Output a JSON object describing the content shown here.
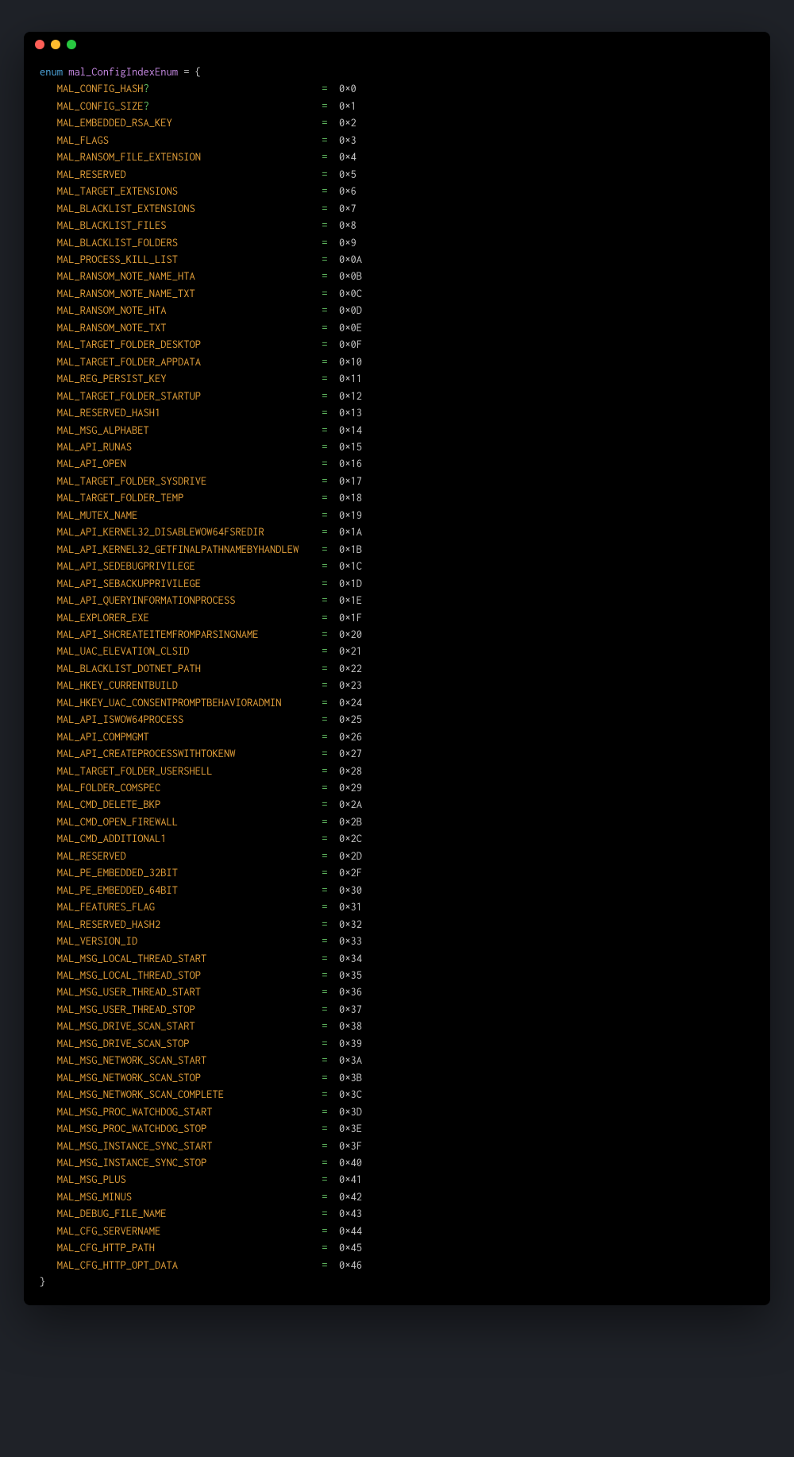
{
  "declaration": {
    "keyword": "enum",
    "identifier": "mal_ConfigIndexEnum",
    "equals": "=",
    "open_brace": "{",
    "close_brace": "}"
  },
  "indent": "   ",
  "name_col_width": 46,
  "members": [
    {
      "name": "MAL_CONFIG_HASH",
      "q": "?",
      "value": "0×0"
    },
    {
      "name": "MAL_CONFIG_SIZE",
      "q": "?",
      "value": "0×1"
    },
    {
      "name": "MAL_EMBEDDED_RSA_KEY",
      "q": "",
      "value": "0×2"
    },
    {
      "name": "MAL_FLAGS",
      "q": "",
      "value": "0×3"
    },
    {
      "name": "MAL_RANSOM_FILE_EXTENSION",
      "q": "",
      "value": "0×4"
    },
    {
      "name": "MAL_RESERVED",
      "q": "",
      "value": "0×5"
    },
    {
      "name": "MAL_TARGET_EXTENSIONS",
      "q": "",
      "value": "0×6"
    },
    {
      "name": "MAL_BLACKLIST_EXTENSIONS",
      "q": "",
      "value": "0×7"
    },
    {
      "name": "MAL_BLACKLIST_FILES",
      "q": "",
      "value": "0×8"
    },
    {
      "name": "MAL_BLACKLIST_FOLDERS",
      "q": "",
      "value": "0×9"
    },
    {
      "name": "MAL_PROCESS_KILL_LIST",
      "q": "",
      "value": "0×0A"
    },
    {
      "name": "MAL_RANSOM_NOTE_NAME_HTA",
      "q": "",
      "value": "0×0B"
    },
    {
      "name": "MAL_RANSOM_NOTE_NAME_TXT",
      "q": "",
      "value": "0×0C"
    },
    {
      "name": "MAL_RANSOM_NOTE_HTA",
      "q": "",
      "value": "0×0D"
    },
    {
      "name": "MAL_RANSOM_NOTE_TXT",
      "q": "",
      "value": "0×0E"
    },
    {
      "name": "MAL_TARGET_FOLDER_DESKTOP",
      "q": "",
      "value": "0×0F"
    },
    {
      "name": "MAL_TARGET_FOLDER_APPDATA",
      "q": "",
      "value": "0×10"
    },
    {
      "name": "MAL_REG_PERSIST_KEY",
      "q": "",
      "value": "0×11"
    },
    {
      "name": "MAL_TARGET_FOLDER_STARTUP",
      "q": "",
      "value": "0×12"
    },
    {
      "name": "MAL_RESERVED_HASH1",
      "q": "",
      "value": "0×13"
    },
    {
      "name": "MAL_MSG_ALPHABET",
      "q": "",
      "value": "0×14"
    },
    {
      "name": "MAL_API_RUNAS",
      "q": "",
      "value": "0×15"
    },
    {
      "name": "MAL_API_OPEN",
      "q": "",
      "value": "0×16"
    },
    {
      "name": "MAL_TARGET_FOLDER_SYSDRIVE",
      "q": "",
      "value": "0×17"
    },
    {
      "name": "MAL_TARGET_FOLDER_TEMP",
      "q": "",
      "value": "0×18"
    },
    {
      "name": "MAL_MUTEX_NAME",
      "q": "",
      "value": "0×19"
    },
    {
      "name": "MAL_API_KERNEL32_DISABLEWOW64FSREDIR",
      "q": "",
      "value": "0×1A"
    },
    {
      "name": "MAL_API_KERNEL32_GETFINALPATHNAMEBYHANDLEW",
      "q": "",
      "value": "0×1B"
    },
    {
      "name": "MAL_API_SEDEBUGPRIVILEGE",
      "q": "",
      "value": "0×1C"
    },
    {
      "name": "MAL_API_SEBACKUPPRIVILEGE",
      "q": "",
      "value": "0×1D"
    },
    {
      "name": "MAL_API_QUERYINFORMATIONPROCESS",
      "q": "",
      "value": "0×1E"
    },
    {
      "name": "MAL_EXPLORER_EXE",
      "q": "",
      "value": "0×1F"
    },
    {
      "name": "MAL_API_SHCREATEITEMFROMPARSINGNAME",
      "q": "",
      "value": "0×20"
    },
    {
      "name": "MAL_UAC_ELEVATION_CLSID",
      "q": "",
      "value": "0×21"
    },
    {
      "name": "MAL_BLACKLIST_DOTNET_PATH",
      "q": "",
      "value": "0×22"
    },
    {
      "name": "MAL_HKEY_CURRENTBUILD",
      "q": "",
      "value": "0×23"
    },
    {
      "name": "MAL_HKEY_UAC_CONSENTPROMPTBEHAVIORADMIN",
      "q": "",
      "value": "0×24"
    },
    {
      "name": "MAL_API_ISWOW64PROCESS",
      "q": "",
      "value": "0×25"
    },
    {
      "name": "MAL_API_COMPMGMT",
      "q": "",
      "value": "0×26"
    },
    {
      "name": "MAL_API_CREATEPROCESSWITHTOKENW",
      "q": "",
      "value": "0×27"
    },
    {
      "name": "MAL_TARGET_FOLDER_USERSHELL",
      "q": "",
      "value": "0×28"
    },
    {
      "name": "MAL_FOLDER_COMSPEC",
      "q": "",
      "value": "0×29"
    },
    {
      "name": "MAL_CMD_DELETE_BKP",
      "q": "",
      "value": "0×2A"
    },
    {
      "name": "MAL_CMD_OPEN_FIREWALL",
      "q": "",
      "value": "0×2B"
    },
    {
      "name": "MAL_CMD_ADDITIONAL1",
      "q": "",
      "value": "0×2C"
    },
    {
      "name": "MAL_RESERVED",
      "q": "",
      "value": "0×2D"
    },
    {
      "name": "MAL_PE_EMBEDDED_32BIT",
      "q": "",
      "value": "0×2F"
    },
    {
      "name": "MAL_PE_EMBEDDED_64BIT",
      "q": "",
      "value": "0×30"
    },
    {
      "name": "MAL_FEATURES_FLAG",
      "q": "",
      "value": "0×31"
    },
    {
      "name": "MAL_RESERVED_HASH2",
      "q": "",
      "value": "0×32"
    },
    {
      "name": "MAL_VERSION_ID",
      "q": "",
      "value": "0×33"
    },
    {
      "name": "MAL_MSG_LOCAL_THREAD_START",
      "q": "",
      "value": "0×34"
    },
    {
      "name": "MAL_MSG_LOCAL_THREAD_STOP",
      "q": "",
      "value": "0×35"
    },
    {
      "name": "MAL_MSG_USER_THREAD_START",
      "q": "",
      "value": "0×36"
    },
    {
      "name": "MAL_MSG_USER_THREAD_STOP",
      "q": "",
      "value": "0×37"
    },
    {
      "name": "MAL_MSG_DRIVE_SCAN_START",
      "q": "",
      "value": "0×38"
    },
    {
      "name": "MAL_MSG_DRIVE_SCAN_STOP",
      "q": "",
      "value": "0×39"
    },
    {
      "name": "MAL_MSG_NETWORK_SCAN_START",
      "q": "",
      "value": "0×3A"
    },
    {
      "name": "MAL_MSG_NETWORK_SCAN_STOP",
      "q": "",
      "value": "0×3B"
    },
    {
      "name": "MAL_MSG_NETWORK_SCAN_COMPLETE",
      "q": "",
      "value": "0×3C"
    },
    {
      "name": "MAL_MSG_PROC_WATCHDOG_START",
      "q": "",
      "value": "0×3D"
    },
    {
      "name": "MAL_MSG_PROC_WATCHDOG_STOP",
      "q": "",
      "value": "0×3E"
    },
    {
      "name": "MAL_MSG_INSTANCE_SYNC_START",
      "q": "",
      "value": "0×3F"
    },
    {
      "name": "MAL_MSG_INSTANCE_SYNC_STOP",
      "q": "",
      "value": "0×40"
    },
    {
      "name": "MAL_MSG_PLUS",
      "q": "",
      "value": "0×41"
    },
    {
      "name": "MAL_MSG_MINUS",
      "q": "",
      "value": "0×42"
    },
    {
      "name": "MAL_DEBUG_FILE_NAME",
      "q": "",
      "value": "0×43"
    },
    {
      "name": "MAL_CFG_SERVERNAME",
      "q": "",
      "value": "0×44"
    },
    {
      "name": "MAL_CFG_HTTP_PATH",
      "q": "",
      "value": "0×45"
    },
    {
      "name": "MAL_CFG_HTTP_OPT_DATA",
      "q": "",
      "value": "0×46"
    }
  ]
}
